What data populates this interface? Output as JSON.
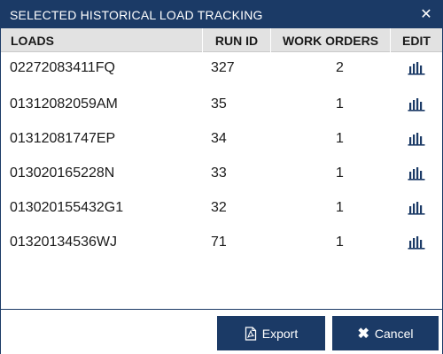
{
  "window": {
    "title": "SELECTED HISTORICAL LOAD TRACKING",
    "close_glyph": "✕"
  },
  "table": {
    "headers": {
      "loads": "LOADS",
      "run_id": "RUN ID",
      "work_orders": "WORK ORDERS",
      "edit": "EDIT"
    },
    "rows": [
      {
        "load": "02272083411FQ",
        "run_id": "327",
        "work_orders": "2"
      },
      {
        "load": "01312082059AM",
        "run_id": "35",
        "work_orders": "1"
      },
      {
        "load": "01312081747EP",
        "run_id": "34",
        "work_orders": "1"
      },
      {
        "load": "013020165228N",
        "run_id": "33",
        "work_orders": "1"
      },
      {
        "load": "013020155432G1",
        "run_id": "32",
        "work_orders": "1"
      },
      {
        "load": "01320134536WJ",
        "run_id": "71",
        "work_orders": "1"
      }
    ],
    "edit_icon": "bar-chart-icon"
  },
  "footer": {
    "export_label": "Export",
    "cancel_label": "Cancel",
    "export_icon": "pdf-file-icon",
    "cancel_icon": "x-icon"
  },
  "colors": {
    "primary": "#1b3a66",
    "header_bg": "#e2e2e2",
    "icon": "#1b3a66"
  }
}
